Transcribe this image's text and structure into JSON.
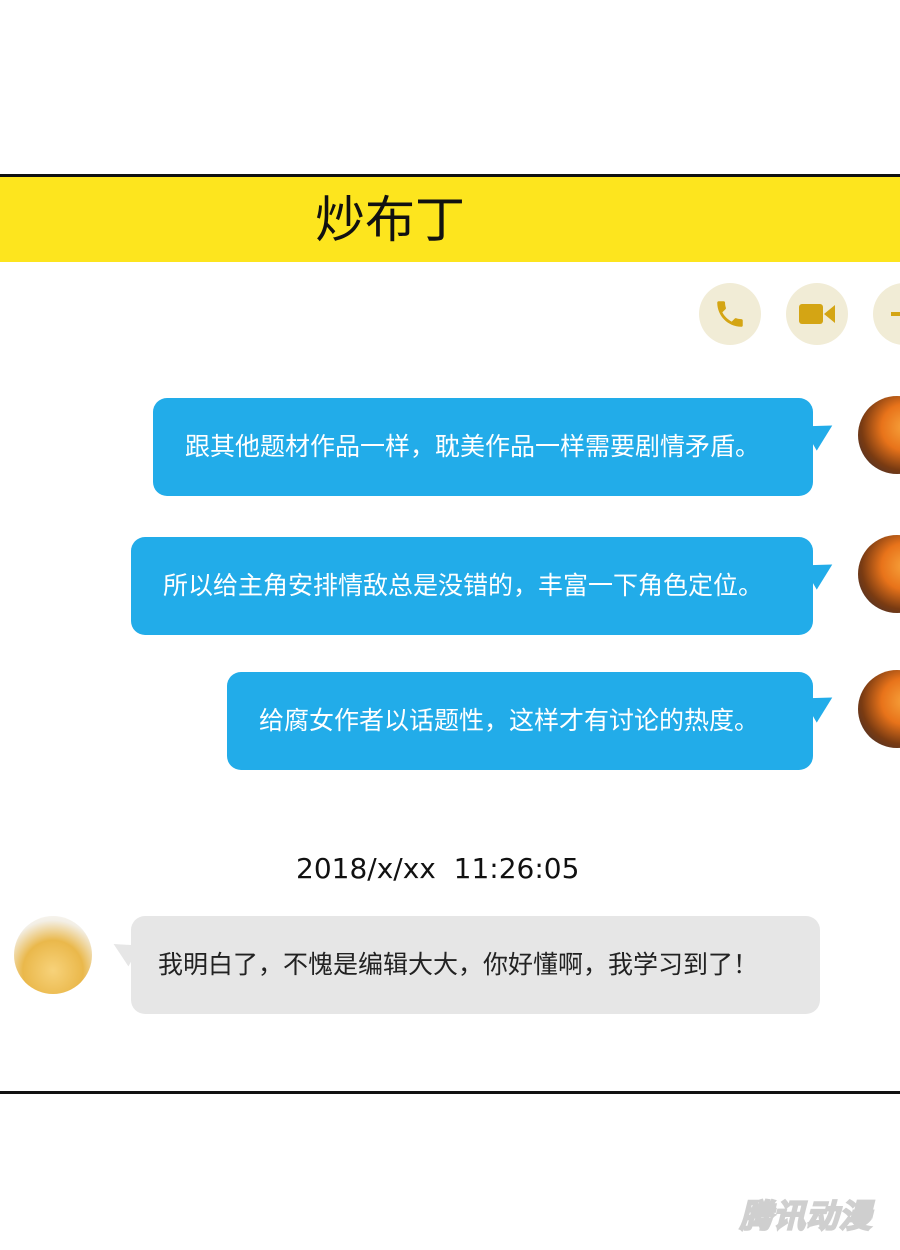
{
  "header": {
    "title": "炒布丁"
  },
  "actions": [
    {
      "name": "phone-call",
      "icon": "phone-icon"
    },
    {
      "name": "video-call",
      "icon": "video-icon"
    },
    {
      "name": "more",
      "icon": "plus-icon"
    }
  ],
  "messages": [
    {
      "direction": "outgoing",
      "text": "跟其他题材作品一样，耽美作品一样需要剧情矛盾。"
    },
    {
      "direction": "outgoing",
      "text": "所以给主角安排情敌总是没错的，丰富一下角色定位。"
    },
    {
      "direction": "outgoing",
      "text": "给腐女作者以话题性，这样才有讨论的热度。"
    },
    {
      "direction": "incoming",
      "text": "我明白了，不愧是编辑大大，你好懂啊，我学习到了！"
    }
  ],
  "timestamp": "2018/x/xx  11:26:05",
  "watermark": "腾讯动漫",
  "colors": {
    "header": "#fde51e",
    "outgoing_bubble": "#22ace9",
    "incoming_bubble": "#e6e6e6",
    "icon_bg": "#f1ecd6",
    "icon_fg": "#d4a514"
  }
}
